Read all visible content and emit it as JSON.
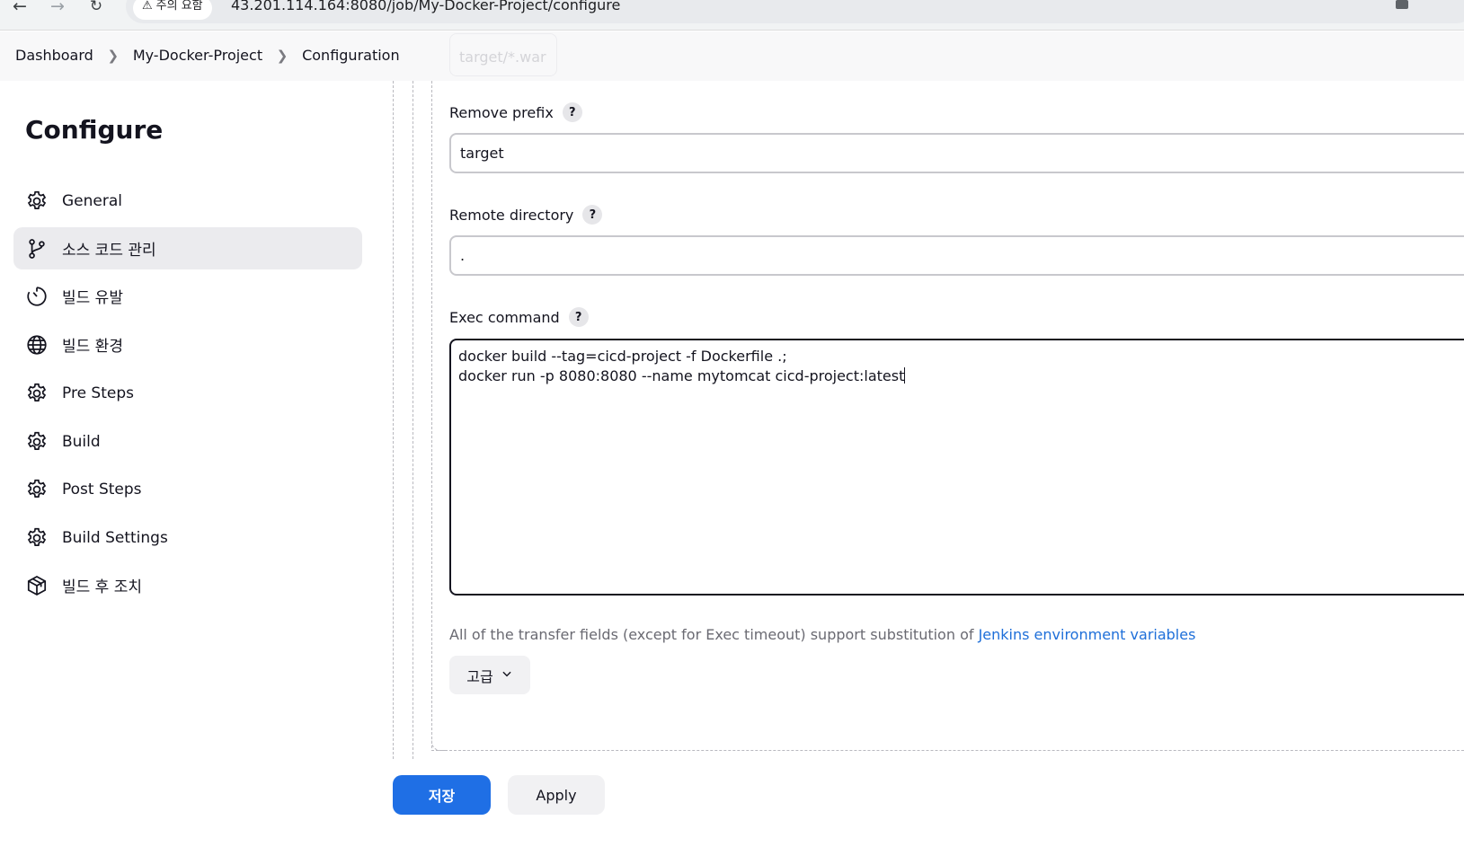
{
  "browser": {
    "security_label": "주의 요함",
    "url": "43.201.114.164:8080/job/My-Docker-Project/configure"
  },
  "breadcrumb": [
    "Dashboard",
    "My-Docker-Project",
    "Configuration"
  ],
  "ghost_field_text": "target/*.war",
  "sidebar": {
    "title": "Configure",
    "active_index": 1,
    "items": [
      {
        "label": "General",
        "icon": "gear-icon"
      },
      {
        "label": "소스 코드 관리",
        "icon": "branch-icon"
      },
      {
        "label": "빌드 유발",
        "icon": "timer-icon"
      },
      {
        "label": "빌드 환경",
        "icon": "globe-icon"
      },
      {
        "label": "Pre Steps",
        "icon": "gear-icon"
      },
      {
        "label": "Build",
        "icon": "gear-icon"
      },
      {
        "label": "Post Steps",
        "icon": "gear-icon"
      },
      {
        "label": "Build Settings",
        "icon": "gear-icon"
      },
      {
        "label": "빌드 후 조치",
        "icon": "package-icon"
      }
    ]
  },
  "form": {
    "help_symbol": "?",
    "remove_prefix": {
      "label": "Remove prefix",
      "value": "target"
    },
    "remote_directory": {
      "label": "Remote directory",
      "value": "."
    },
    "exec_command": {
      "label": "Exec command",
      "lines": [
        "docker build --tag=cicd-project -f Dockerfile .;",
        "docker run -p 8080:8080 --name mytomcat cicd-project:latest"
      ]
    },
    "help_text": "All of the transfer fields (except for Exec timeout) support substitution of ",
    "help_link": "Jenkins environment variables",
    "advanced_label": "고급"
  },
  "buttons": {
    "save": "저장",
    "apply": "Apply"
  },
  "colors": {
    "primary": "#1f6fe5",
    "link": "#1e6fd9",
    "active_bg": "#ebebee"
  }
}
